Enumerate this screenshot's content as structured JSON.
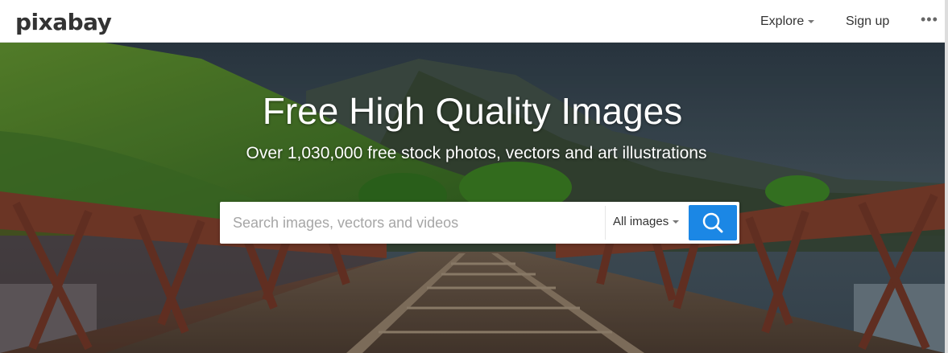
{
  "header": {
    "logo": "pixabay",
    "explore_label": "Explore",
    "signup_label": "Sign up",
    "more_label": "•••"
  },
  "hero": {
    "title": "Free High Quality Images",
    "subtitle": "Over 1,030,000 free stock photos, vectors and art illustrations"
  },
  "search": {
    "placeholder": "Search images, vectors and videos",
    "value": "",
    "type_label": "All images",
    "button_icon": "search-icon"
  },
  "colors": {
    "accent": "#1b87e5",
    "text": "#333333"
  }
}
